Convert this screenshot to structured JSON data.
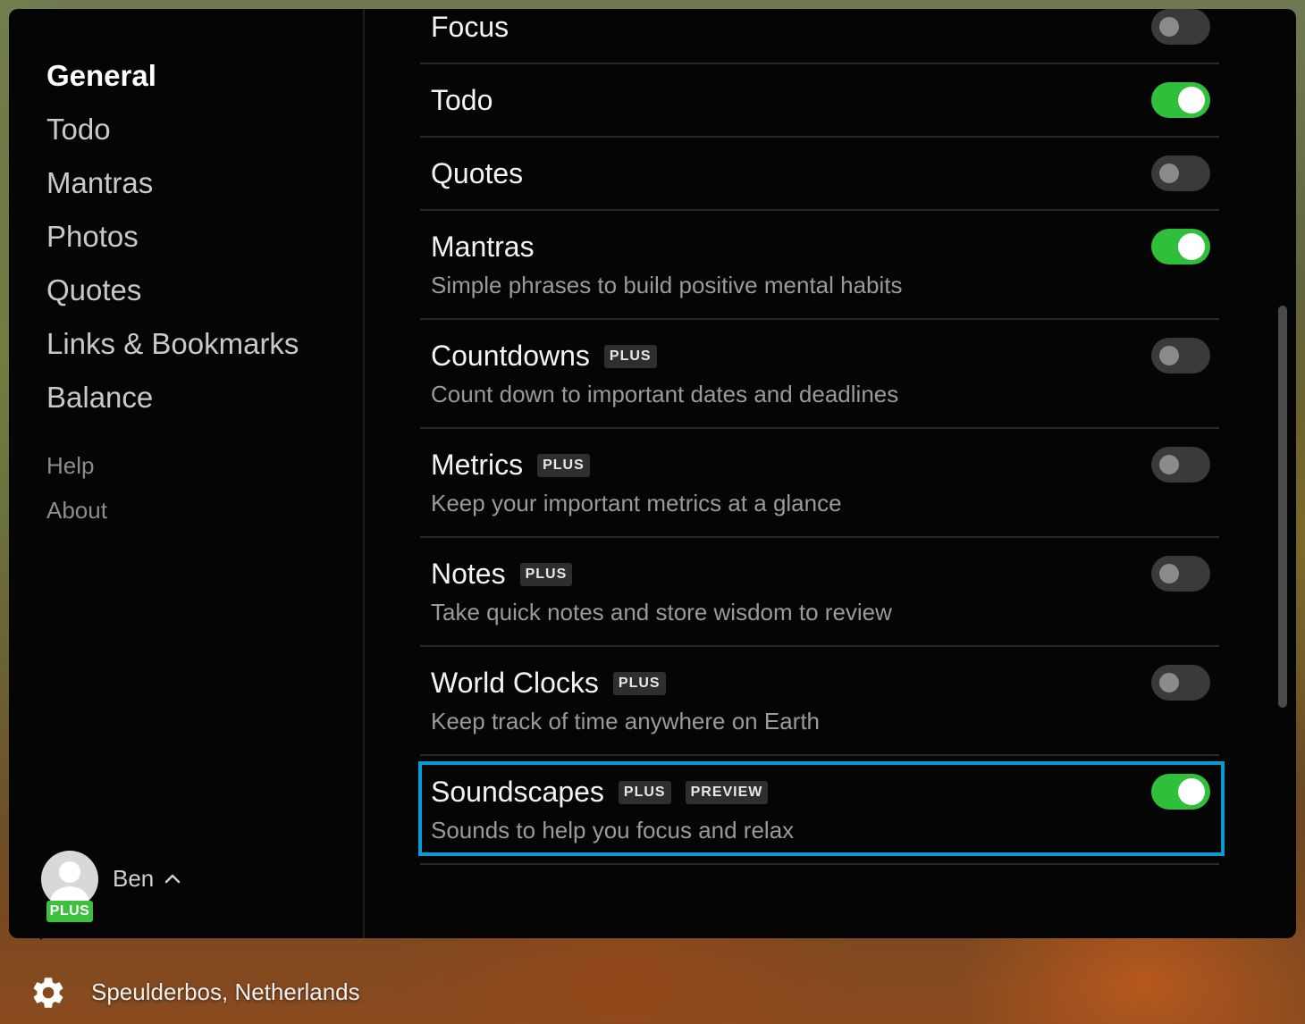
{
  "sidebar": {
    "items": [
      {
        "label": "General",
        "active": true
      },
      {
        "label": "Todo"
      },
      {
        "label": "Mantras"
      },
      {
        "label": "Photos"
      },
      {
        "label": "Quotes"
      },
      {
        "label": "Links & Bookmarks"
      },
      {
        "label": "Balance"
      }
    ],
    "secondary": [
      {
        "label": "Help"
      },
      {
        "label": "About"
      }
    ],
    "user": {
      "name": "Ben",
      "badge": "PLUS"
    }
  },
  "settings": {
    "rows": [
      {
        "title": "Focus",
        "enabled": false
      },
      {
        "title": "Todo",
        "enabled": true
      },
      {
        "title": "Quotes",
        "enabled": false
      },
      {
        "title": "Mantras",
        "desc": "Simple phrases to build positive mental habits",
        "enabled": true
      },
      {
        "title": "Countdowns",
        "badge": "PLUS",
        "desc": "Count down to important dates and deadlines",
        "enabled": false
      },
      {
        "title": "Metrics",
        "badge": "PLUS",
        "desc": "Keep your important metrics at a glance",
        "enabled": false
      },
      {
        "title": "Notes",
        "badge": "PLUS",
        "desc": "Take quick notes and store wisdom to review",
        "enabled": false
      },
      {
        "title": "World Clocks",
        "badge": "PLUS",
        "desc": "Keep track of time anywhere on Earth",
        "enabled": false
      },
      {
        "title": "Soundscapes",
        "badge": "PLUS",
        "badge2": "PREVIEW",
        "desc": "Sounds to help you focus and relax",
        "enabled": true
      }
    ]
  },
  "footer": {
    "location": "Speulderbos, Netherlands"
  },
  "colors": {
    "toggle_on": "#2fbf3a",
    "highlight": "#0a9ad6",
    "plus_badge": "#3fbf3f"
  }
}
